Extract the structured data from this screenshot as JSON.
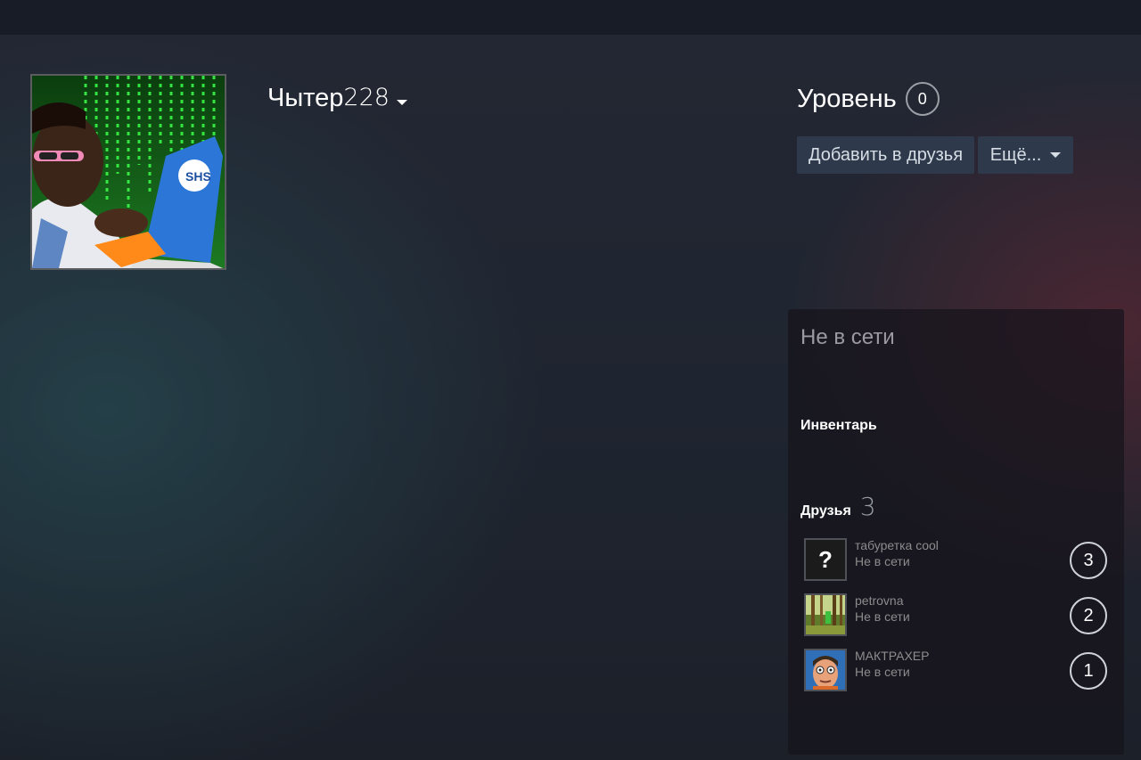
{
  "profile": {
    "name_prefix": "Чытер",
    "name_suffix": "228",
    "avatar": "matrix-laptop-avatar"
  },
  "level": {
    "label": "Уровень",
    "value": "0"
  },
  "actions": {
    "add_friend_label": "Добавить в друзья",
    "more_label": "Ещё..."
  },
  "sidebar": {
    "status": "Не в сети",
    "inventory_label": "Инвентарь",
    "friends_label": "Друзья",
    "friends_count": "3",
    "friends": [
      {
        "name": "табуретка cool",
        "status": "Не в сети",
        "level": "3",
        "avatar": "question-mark-avatar"
      },
      {
        "name": "petrovna",
        "status": "Не в сети",
        "level": "2",
        "avatar": "forest-avatar"
      },
      {
        "name": "МАКТРАХЕР",
        "status": "Не в сети",
        "level": "1",
        "avatar": "cartoon-face-avatar"
      }
    ]
  },
  "colors": {
    "topbar": "#171c26",
    "button_bg": "#2e3a4b",
    "panel_bg": "#16141c"
  }
}
